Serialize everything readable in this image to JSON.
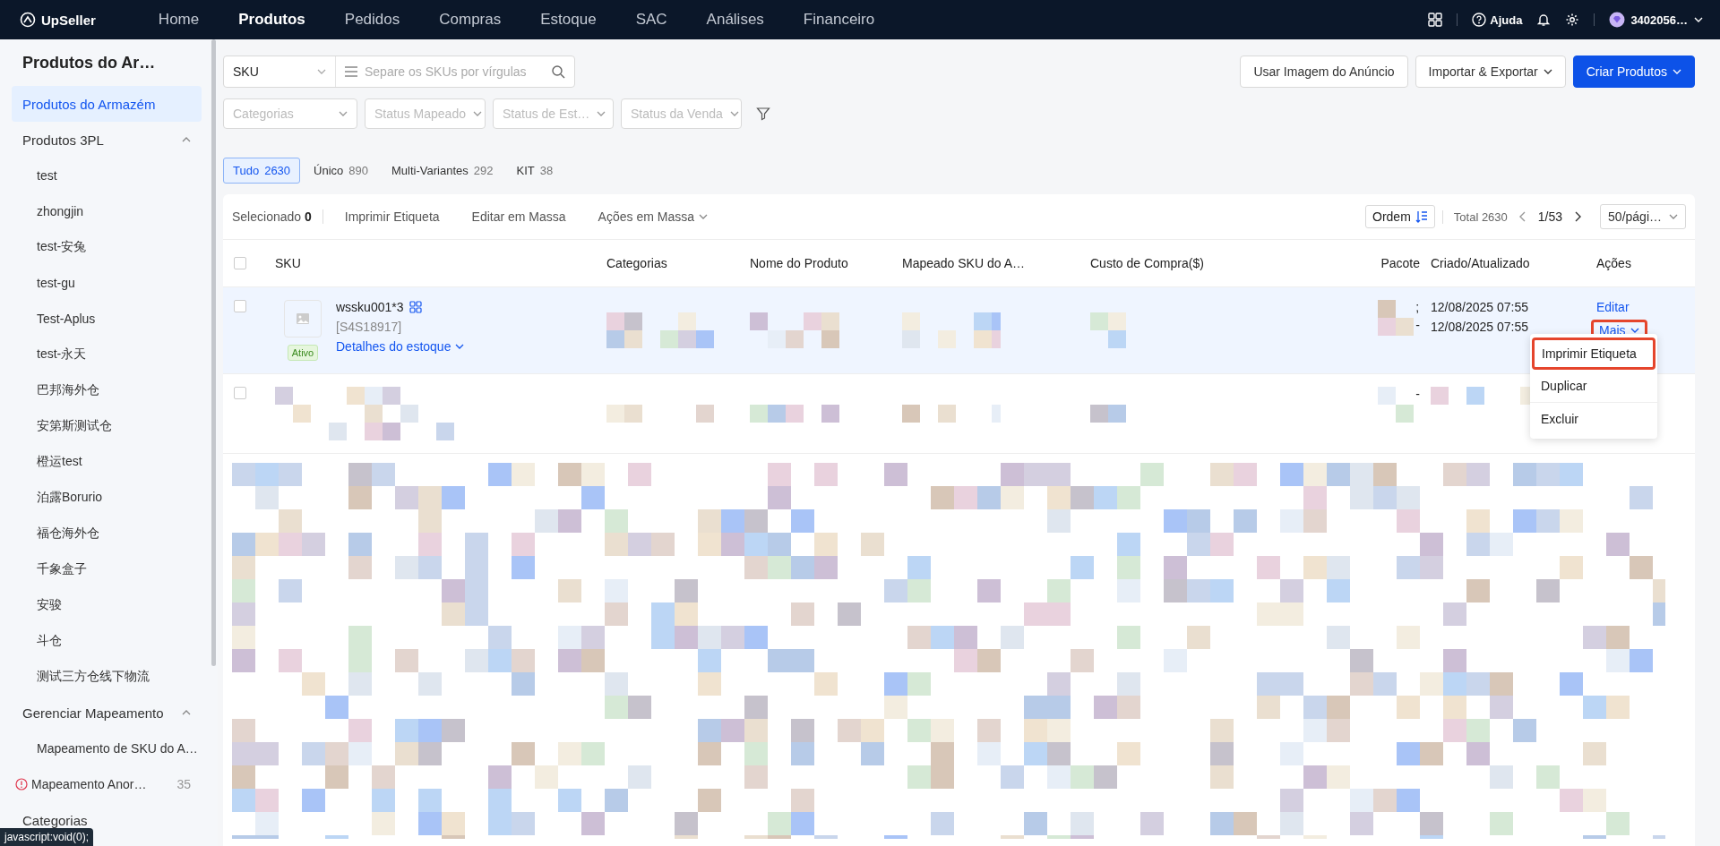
{
  "topbar": {
    "logo": "UpSeller",
    "nav": [
      {
        "label": "Home",
        "selected": false
      },
      {
        "label": "Produtos",
        "selected": true
      },
      {
        "label": "Pedidos",
        "selected": false
      },
      {
        "label": "Compras",
        "selected": false
      },
      {
        "label": "Estoque",
        "selected": false
      },
      {
        "label": "SAC",
        "selected": false
      },
      {
        "label": "Análises",
        "selected": false
      },
      {
        "label": "Financeiro",
        "selected": false
      }
    ],
    "help": "Ajuda",
    "account": "3402056…"
  },
  "sidebar": {
    "title": "Produtos do Ar…",
    "items": [
      {
        "label": "Produtos do Armazém",
        "selected": true
      },
      {
        "label": "Produtos 3PL",
        "selected": false,
        "expanded": true,
        "children": [
          {
            "label": "test",
            "selected": false
          },
          {
            "label": "zhongjin",
            "selected": false
          },
          {
            "label": "test-安兔",
            "selected": false
          },
          {
            "label": "test-gu",
            "selected": false
          },
          {
            "label": "Test-Aplus",
            "selected": false
          },
          {
            "label": "test-永天",
            "selected": false
          },
          {
            "label": "巴邦海外仓",
            "selected": false
          },
          {
            "label": "安第斯测试仓",
            "selected": false
          },
          {
            "label": "橙运test",
            "selected": false
          },
          {
            "label": "泊露Borurio",
            "selected": false
          },
          {
            "label": "福仓海外仓",
            "selected": false
          },
          {
            "label": "千象盒子",
            "selected": false
          },
          {
            "label": "安骏",
            "selected": false
          },
          {
            "label": "斗仓",
            "selected": false
          },
          {
            "label": "测试三方仓线下物流",
            "selected": false
          }
        ]
      },
      {
        "label": "Gerenciar Mapeamento",
        "selected": false,
        "expanded": true,
        "children": [
          {
            "label": "Mapeamento de SKU do A…",
            "selected": false
          },
          {
            "label": "Mapeamento Anor…",
            "selected": false,
            "kind": "warning",
            "count": "35"
          }
        ]
      },
      {
        "label": "Categorias",
        "selected": false
      }
    ]
  },
  "search": {
    "type": "SKU",
    "placeholder": "Separe os SKUs por vírgulas"
  },
  "actions": [
    {
      "label": "Usar Imagem do Anúncio",
      "kind": "plain"
    },
    {
      "label": "Importar & Exportar",
      "kind": "menu"
    },
    {
      "label": "Criar Produtos",
      "kind": "primary"
    }
  ],
  "filters": [
    {
      "placeholder": "Categorias"
    },
    {
      "placeholder": "Status Mapeado"
    },
    {
      "placeholder": "Status de Est…"
    },
    {
      "placeholder": "Status da Venda"
    }
  ],
  "tabs": [
    {
      "label": "Tudo",
      "count": "2630",
      "selected": true
    },
    {
      "label": "Único",
      "count": "890",
      "selected": false
    },
    {
      "label": "Multi-Variantes",
      "count": "292",
      "selected": false
    },
    {
      "label": "KIT",
      "count": "38",
      "selected": false
    }
  ],
  "toolbar": {
    "selected_label": "Selecionado",
    "selected_count": "0",
    "buttons": [
      "Imprimir Etiqueta",
      "Editar em Massa",
      "Ações em Massa"
    ],
    "sort": "Ordem",
    "total": "Total 2630",
    "page": "1/53",
    "page_size": "50/pági…"
  },
  "table": {
    "select_all_checked": false,
    "columns": [
      "SKU",
      "Categorias",
      "Nome do Produto",
      "Mapeado SKU do A…",
      "Custo de Compra($)",
      "Pacote",
      "Criado/Atualizado",
      "Ações"
    ],
    "rows": [
      {
        "checked": false,
        "status": "Ativo",
        "sku": "wssku001*3",
        "code": "[S4S18917]",
        "stock_link": "Detalhes do estoque",
        "pacote": [
          ";",
          "-"
        ],
        "dates": [
          "12/08/2025 07:55",
          "12/08/2025 07:55"
        ],
        "actions": [
          "Editar",
          "Mais"
        ],
        "hover": true
      },
      {
        "checked": false,
        "pacote": [
          "-"
        ],
        "hover": false
      }
    ]
  },
  "menu": {
    "items": [
      {
        "label": "Imprimir Etiqueta",
        "outlined": true
      },
      {
        "label": "Duplicar",
        "outlined": false
      },
      {
        "label": "Excluir",
        "outlined": false
      }
    ],
    "trigger_outlined": true
  },
  "status_bar": "javascript:void(0);"
}
